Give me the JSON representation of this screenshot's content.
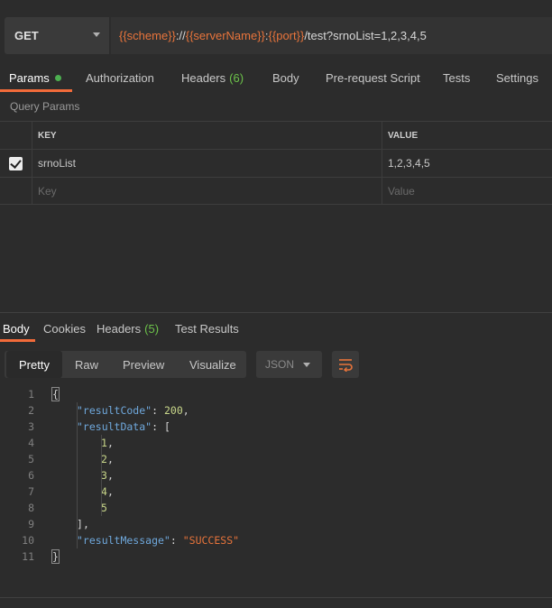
{
  "request": {
    "method": "GET",
    "url_parts": [
      {
        "text": "{{scheme}}",
        "var": true
      },
      {
        "text": "://",
        "var": false
      },
      {
        "text": "{{serverName}}",
        "var": true
      },
      {
        "text": ":",
        "var": false
      },
      {
        "text": "{{port}}",
        "var": true
      },
      {
        "text": "/test?srnoList=1,2,3,4,5",
        "var": false
      }
    ]
  },
  "request_tabs": {
    "params": "Params",
    "authorization": "Authorization",
    "headers": "Headers",
    "headers_count": "(6)",
    "body": "Body",
    "prerequest": "Pre-request Script",
    "tests": "Tests",
    "settings": "Settings"
  },
  "query_params": {
    "label": "Query Params",
    "key_header": "KEY",
    "value_header": "VALUE",
    "rows": [
      {
        "key": "srnoList",
        "value": "1,2,3,4,5",
        "checked": true
      }
    ],
    "key_placeholder": "Key",
    "value_placeholder": "Value"
  },
  "response_tabs": {
    "body": "Body",
    "cookies": "Cookies",
    "headers": "Headers",
    "headers_count": "(5)",
    "test_results": "Test Results"
  },
  "view_modes": {
    "pretty": "Pretty",
    "raw": "Raw",
    "preview": "Preview",
    "visualize": "Visualize",
    "format": "JSON"
  },
  "code_lines": [
    {
      "num": "1",
      "text": "{"
    },
    {
      "num": "2",
      "text": "\"resultCode\": 200,"
    },
    {
      "num": "3",
      "text": "\"resultData\": ["
    },
    {
      "num": "4",
      "text": "1,"
    },
    {
      "num": "5",
      "text": "2,"
    },
    {
      "num": "6",
      "text": "3,"
    },
    {
      "num": "7",
      "text": "4,"
    },
    {
      "num": "8",
      "text": "5"
    },
    {
      "num": "9",
      "text": "],"
    },
    {
      "num": "10",
      "text": "\"resultMessage\": \"SUCCESS\""
    },
    {
      "num": "11",
      "text": "}"
    }
  ],
  "colors": {
    "accent": "#f26b3a",
    "variable": "#e8743b",
    "json_key": "#6fa8dc",
    "json_number": "#c9d78a",
    "json_string": "#e8743b",
    "count_green": "#6cc24a"
  },
  "icons": {
    "method_dropdown": "chevron-down-icon",
    "format_dropdown": "chevron-down-icon",
    "wrap": "wrap-lines-icon",
    "param_status": "status-dot-icon",
    "row_check": "checkbox-checked-icon"
  }
}
